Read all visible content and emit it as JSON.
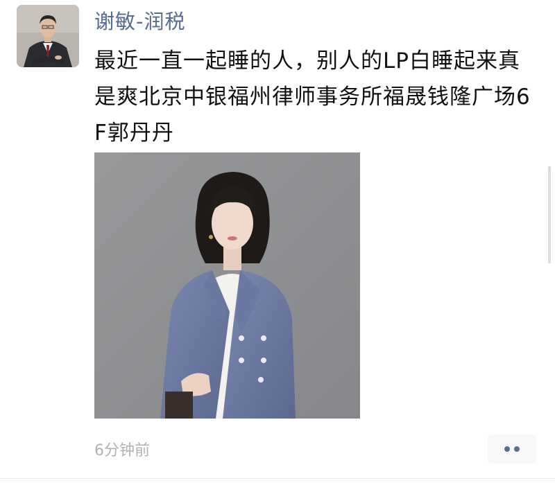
{
  "post": {
    "author": "谢敏-润税",
    "text": "最近一直一起睡的人，别人的LP白睡起来真是爽北京中银福州律师事务所福晟钱隆广场6F郭丹丹",
    "timestamp": "6分钟前"
  },
  "icons": {
    "avatar": "user-avatar-photo",
    "photo": "post-photo-woman-in-blazer",
    "more": "more-dots-icon"
  },
  "colors": {
    "author_link": "#576b95",
    "text": "#111111",
    "timestamp": "#b2b2b2",
    "more_button_bg": "#f7f7f7"
  }
}
